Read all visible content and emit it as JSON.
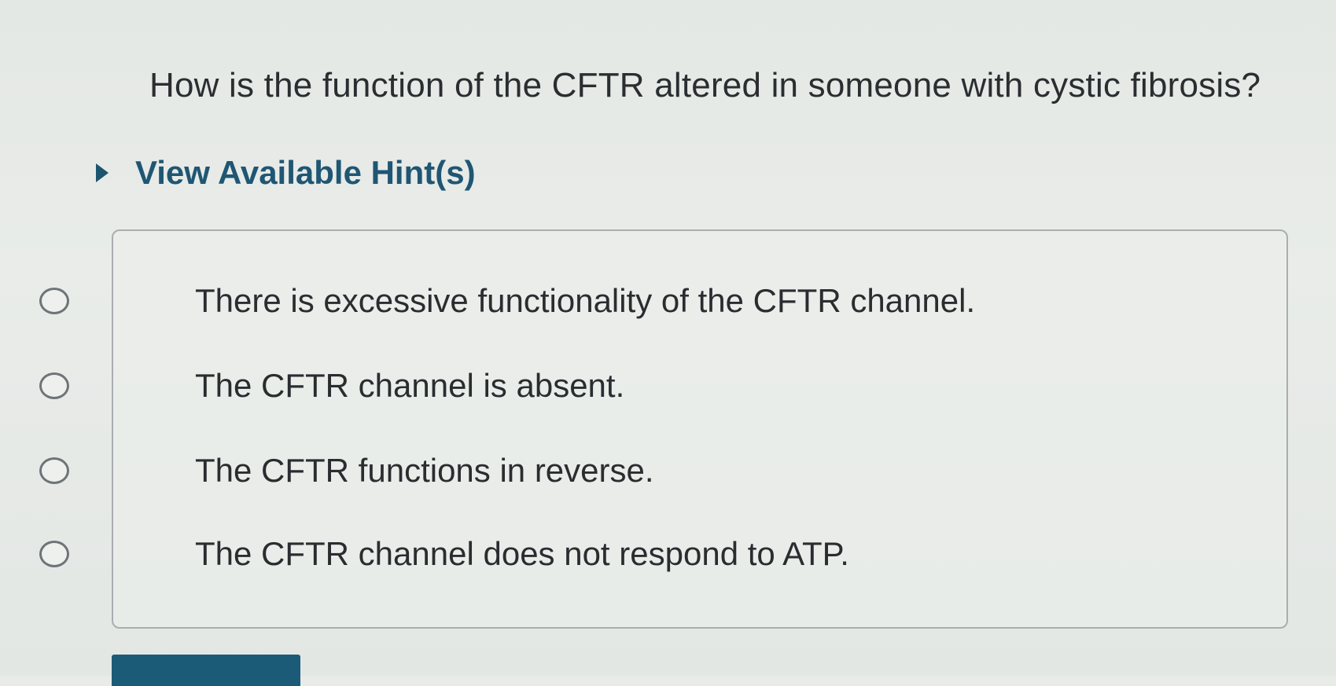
{
  "question": {
    "text": "How is the function of the CFTR altered in someone with cystic fibrosis?"
  },
  "hints": {
    "label": "View Available Hint(s)",
    "icon": "caret-right-icon",
    "expanded": false
  },
  "options": [
    {
      "label": "There is excessive functionality of the CFTR channel.",
      "selected": false
    },
    {
      "label": "The CFTR channel is absent.",
      "selected": false
    },
    {
      "label": "The CFTR functions in reverse.",
      "selected": false
    },
    {
      "label": "The CFTR channel does not respond to ATP.",
      "selected": false
    }
  ],
  "colors": {
    "accent": "#1f5673",
    "button": "#1c5b78",
    "text": "#2a2d30",
    "border": "#a9aeaf"
  }
}
